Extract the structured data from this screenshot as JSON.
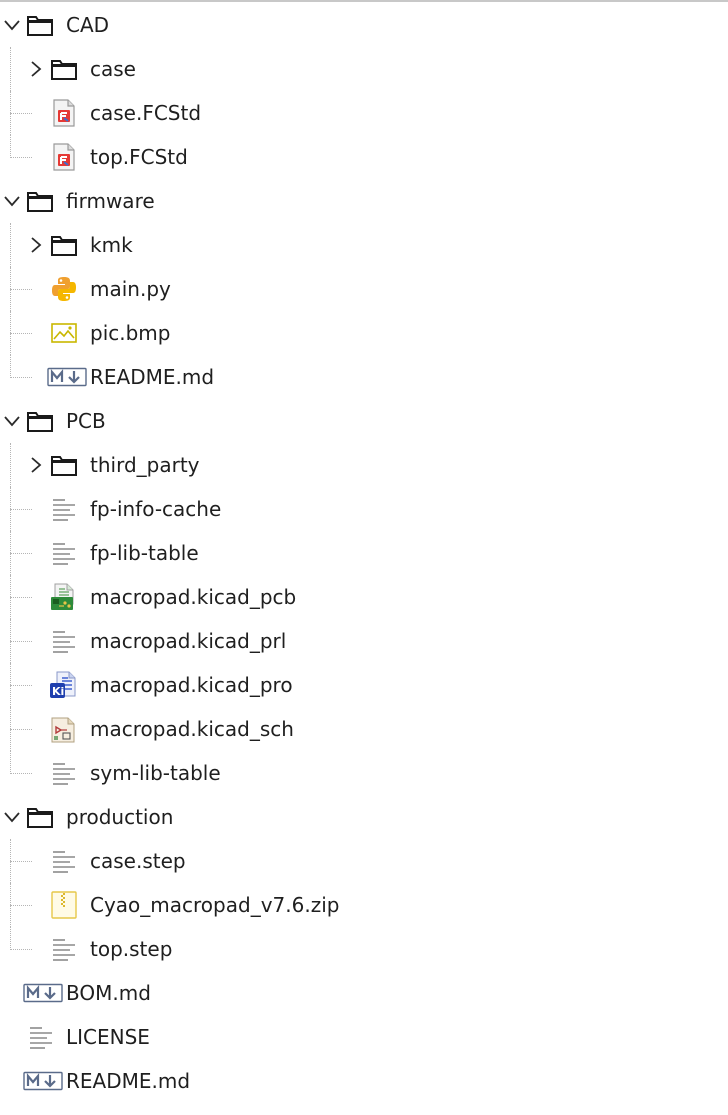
{
  "tree": [
    {
      "label": "CAD",
      "depth": 0,
      "kind": "folder",
      "state": "open",
      "icon": "folder-icon"
    },
    {
      "label": "case",
      "depth": 1,
      "kind": "folder",
      "state": "closed",
      "icon": "folder-icon"
    },
    {
      "label": "case.FCStd",
      "depth": 1,
      "kind": "file",
      "icon": "freecad-file-icon"
    },
    {
      "label": "top.FCStd",
      "depth": 1,
      "kind": "file",
      "icon": "freecad-file-icon",
      "last": true
    },
    {
      "label": "firmware",
      "depth": 0,
      "kind": "folder",
      "state": "open",
      "icon": "folder-icon"
    },
    {
      "label": "kmk",
      "depth": 1,
      "kind": "folder",
      "state": "closed",
      "icon": "folder-icon"
    },
    {
      "label": "main.py",
      "depth": 1,
      "kind": "file",
      "icon": "python-file-icon"
    },
    {
      "label": "pic.bmp",
      "depth": 1,
      "kind": "file",
      "icon": "image-file-icon"
    },
    {
      "label": "README.md",
      "depth": 1,
      "kind": "file",
      "icon": "markdown-file-icon",
      "last": true
    },
    {
      "label": "PCB",
      "depth": 0,
      "kind": "folder",
      "state": "open",
      "icon": "folder-icon"
    },
    {
      "label": "third_party",
      "depth": 1,
      "kind": "folder",
      "state": "closed",
      "icon": "folder-icon"
    },
    {
      "label": "fp-info-cache",
      "depth": 1,
      "kind": "file",
      "icon": "text-file-icon"
    },
    {
      "label": "fp-lib-table",
      "depth": 1,
      "kind": "file",
      "icon": "text-file-icon"
    },
    {
      "label": "macropad.kicad_pcb",
      "depth": 1,
      "kind": "file",
      "icon": "kicad-pcb-file-icon"
    },
    {
      "label": "macropad.kicad_prl",
      "depth": 1,
      "kind": "file",
      "icon": "text-file-icon"
    },
    {
      "label": "macropad.kicad_pro",
      "depth": 1,
      "kind": "file",
      "icon": "kicad-project-file-icon"
    },
    {
      "label": "macropad.kicad_sch",
      "depth": 1,
      "kind": "file",
      "icon": "kicad-schematic-file-icon"
    },
    {
      "label": "sym-lib-table",
      "depth": 1,
      "kind": "file",
      "icon": "text-file-icon",
      "last": true
    },
    {
      "label": "production",
      "depth": 0,
      "kind": "folder",
      "state": "open",
      "icon": "folder-icon"
    },
    {
      "label": "case.step",
      "depth": 1,
      "kind": "file",
      "icon": "text-file-icon"
    },
    {
      "label": "Cyao_macropad_v7.6.zip",
      "depth": 1,
      "kind": "file",
      "icon": "zip-file-icon"
    },
    {
      "label": "top.step",
      "depth": 1,
      "kind": "file",
      "icon": "text-file-icon",
      "last": true
    },
    {
      "label": "BOM.md",
      "depth": 0,
      "kind": "file",
      "icon": "markdown-file-icon"
    },
    {
      "label": "LICENSE",
      "depth": 0,
      "kind": "file",
      "icon": "text-file-icon"
    },
    {
      "label": "README.md",
      "depth": 0,
      "kind": "file",
      "icon": "markdown-file-icon"
    }
  ],
  "colors": {
    "text": "#1f1f1f",
    "guide": "#b5b5b5",
    "python_blue": "#f0a030",
    "python_yellow": "#f5b700",
    "image_yellow": "#c9b700",
    "kicad_blue": "#3355cc",
    "pcb_green": "#2e8b3a"
  }
}
